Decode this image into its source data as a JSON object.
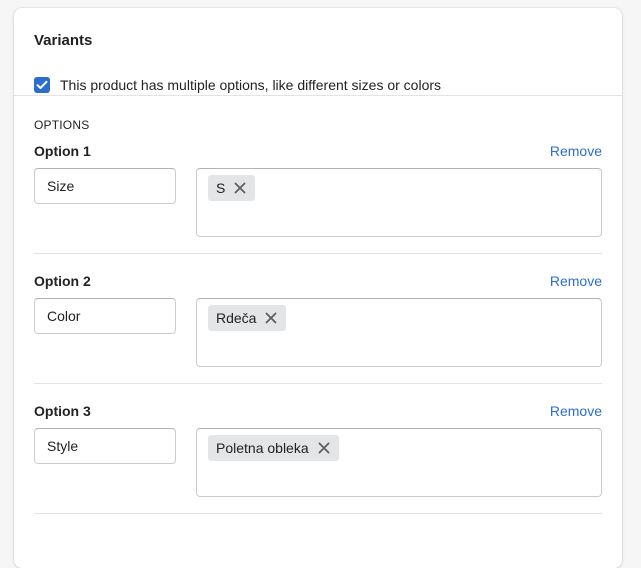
{
  "card": {
    "title": "Variants",
    "multiple_options_label": "This product has multiple options, like different sizes or colors",
    "multiple_options_checked": true
  },
  "options": {
    "heading": "OPTIONS",
    "remove_label": "Remove",
    "items": [
      {
        "label": "Option 1",
        "name": "Size",
        "values": [
          "S"
        ]
      },
      {
        "label": "Option 2",
        "name": "Color",
        "values": [
          "Rdeča"
        ]
      },
      {
        "label": "Option 3",
        "name": "Style",
        "values": [
          "Poletna obleka"
        ]
      }
    ]
  },
  "colors": {
    "accent": "#2c6ecb",
    "tag_background": "#e4e5e7",
    "border": "#c9cccf"
  },
  "icons": {
    "checkbox": "checkmark-icon",
    "tag_remove": "close-icon"
  }
}
